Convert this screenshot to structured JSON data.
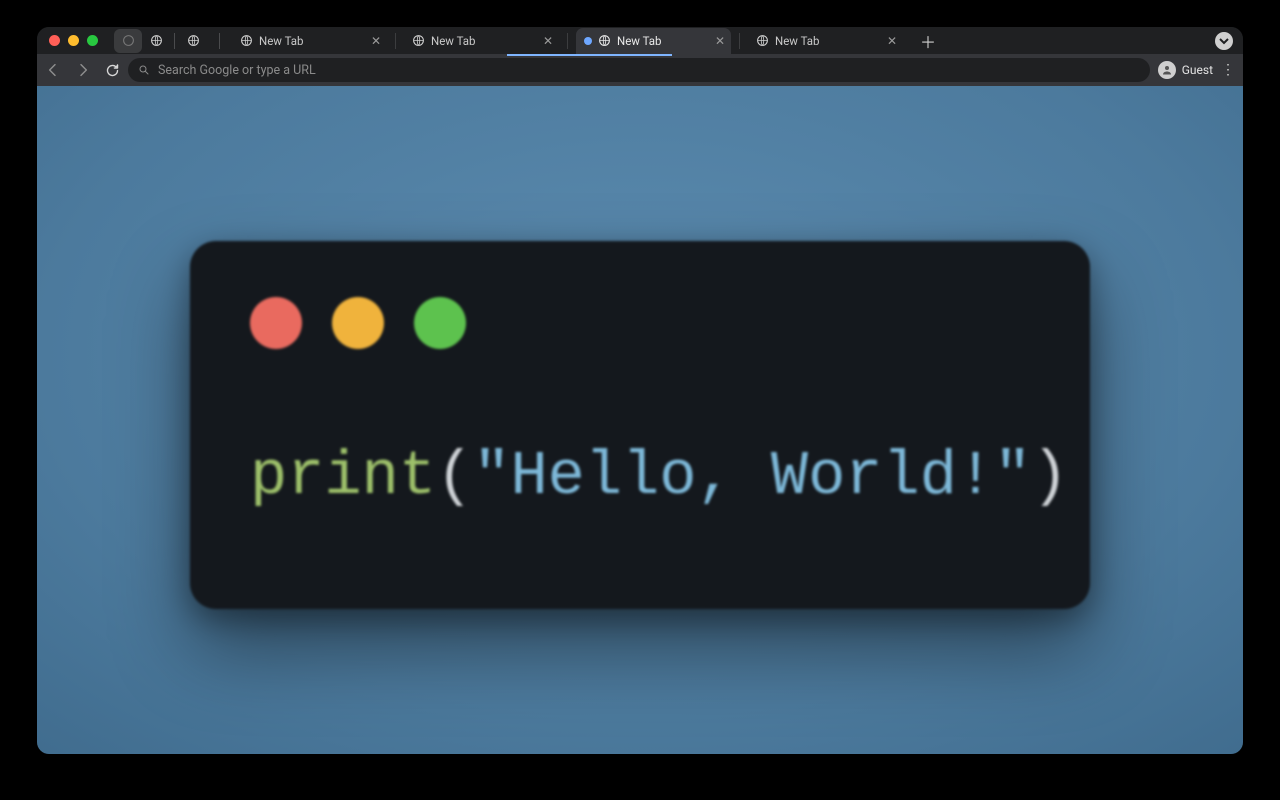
{
  "browser": {
    "tabs": [
      {
        "label": "New Tab"
      },
      {
        "label": "New Tab"
      },
      {
        "label": "New Tab"
      },
      {
        "label": "New Tab"
      }
    ],
    "active_tab_index": 2,
    "omnibox_placeholder": "Search Google or type a URL",
    "profile_label": "Guest"
  },
  "content": {
    "code": {
      "function": "print",
      "open": "(",
      "string": "\"Hello, World!\"",
      "close": ")"
    }
  }
}
